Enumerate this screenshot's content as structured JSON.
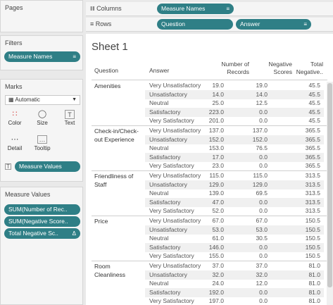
{
  "left": {
    "pages_title": "Pages",
    "filters_title": "Filters",
    "filter_pill": "Measure Names",
    "marks_title": "Marks",
    "mark_type": "Automatic",
    "mark_buttons": [
      "Color",
      "Size",
      "Text",
      "Detail",
      "Tooltip"
    ],
    "measure_values_pill": "Measure Values",
    "measure_values_title": "Measure Values",
    "measure_pills": [
      "SUM(Number of Rec..",
      "SUM(Negative Score..",
      "Total Negative Sc.."
    ]
  },
  "shelves": {
    "columns_label": "Columns",
    "rows_label": "Rows",
    "columns_pill": "Measure Names",
    "rows_pills": [
      "Question",
      "Answer"
    ]
  },
  "sheet": {
    "title": "Sheet 1",
    "headers": {
      "question": "Question",
      "answer": "Answer",
      "col1_line1": "Number of",
      "col1_line2": "Records",
      "col2_line1": "Negative",
      "col2_line2": "Scores",
      "col3_line1": "Total",
      "col3_line2": "Negative.."
    },
    "groups": [
      {
        "question_lines": [
          "Amenities"
        ],
        "rows": [
          {
            "answer": "Very Unsatisfactory",
            "v1": "19.0",
            "v2": "19.0",
            "v3": "45.5"
          },
          {
            "answer": "Unsatisfactory",
            "v1": "14.0",
            "v2": "14.0",
            "v3": "45.5"
          },
          {
            "answer": "Neutral",
            "v1": "25.0",
            "v2": "12.5",
            "v3": "45.5"
          },
          {
            "answer": "Satisfactory",
            "v1": "223.0",
            "v2": "0.0",
            "v3": "45.5"
          },
          {
            "answer": "Very Satisfactory",
            "v1": "201.0",
            "v2": "0.0",
            "v3": "45.5"
          }
        ]
      },
      {
        "question_lines": [
          "Check-in/Check-",
          "out Experience"
        ],
        "rows": [
          {
            "answer": "Very Unsatisfactory",
            "v1": "137.0",
            "v2": "137.0",
            "v3": "365.5"
          },
          {
            "answer": "Unsatisfactory",
            "v1": "152.0",
            "v2": "152.0",
            "v3": "365.5"
          },
          {
            "answer": "Neutral",
            "v1": "153.0",
            "v2": "76.5",
            "v3": "365.5"
          },
          {
            "answer": "Satisfactory",
            "v1": "17.0",
            "v2": "0.0",
            "v3": "365.5"
          },
          {
            "answer": "Very Satisfactory",
            "v1": "23.0",
            "v2": "0.0",
            "v3": "365.5"
          }
        ]
      },
      {
        "question_lines": [
          "Friendliness of",
          "Staff"
        ],
        "rows": [
          {
            "answer": "Very Unsatisfactory",
            "v1": "115.0",
            "v2": "115.0",
            "v3": "313.5"
          },
          {
            "answer": "Unsatisfactory",
            "v1": "129.0",
            "v2": "129.0",
            "v3": "313.5"
          },
          {
            "answer": "Neutral",
            "v1": "139.0",
            "v2": "69.5",
            "v3": "313.5"
          },
          {
            "answer": "Satisfactory",
            "v1": "47.0",
            "v2": "0.0",
            "v3": "313.5"
          },
          {
            "answer": "Very Satisfactory",
            "v1": "52.0",
            "v2": "0.0",
            "v3": "313.5"
          }
        ]
      },
      {
        "question_lines": [
          "Price"
        ],
        "rows": [
          {
            "answer": "Very Unsatisfactory",
            "v1": "67.0",
            "v2": "67.0",
            "v3": "150.5"
          },
          {
            "answer": "Unsatisfactory",
            "v1": "53.0",
            "v2": "53.0",
            "v3": "150.5"
          },
          {
            "answer": "Neutral",
            "v1": "61.0",
            "v2": "30.5",
            "v3": "150.5"
          },
          {
            "answer": "Satisfactory",
            "v1": "146.0",
            "v2": "0.0",
            "v3": "150.5"
          },
          {
            "answer": "Very Satisfactory",
            "v1": "155.0",
            "v2": "0.0",
            "v3": "150.5"
          }
        ]
      },
      {
        "question_lines": [
          "Room",
          "Cleanliness"
        ],
        "rows": [
          {
            "answer": "Very Unsatisfactory",
            "v1": "37.0",
            "v2": "37.0",
            "v3": "81.0"
          },
          {
            "answer": "Unsatisfactory",
            "v1": "32.0",
            "v2": "32.0",
            "v3": "81.0"
          },
          {
            "answer": "Neutral",
            "v1": "24.0",
            "v2": "12.0",
            "v3": "81.0"
          },
          {
            "answer": "Satisfactory",
            "v1": "192.0",
            "v2": "0.0",
            "v3": "81.0"
          },
          {
            "answer": "Very Satisfactory",
            "v1": "197.0",
            "v2": "0.0",
            "v3": "81.0"
          }
        ]
      }
    ]
  },
  "colors": {
    "pill": "#2f7f86",
    "background": "#e9e9e9"
  }
}
